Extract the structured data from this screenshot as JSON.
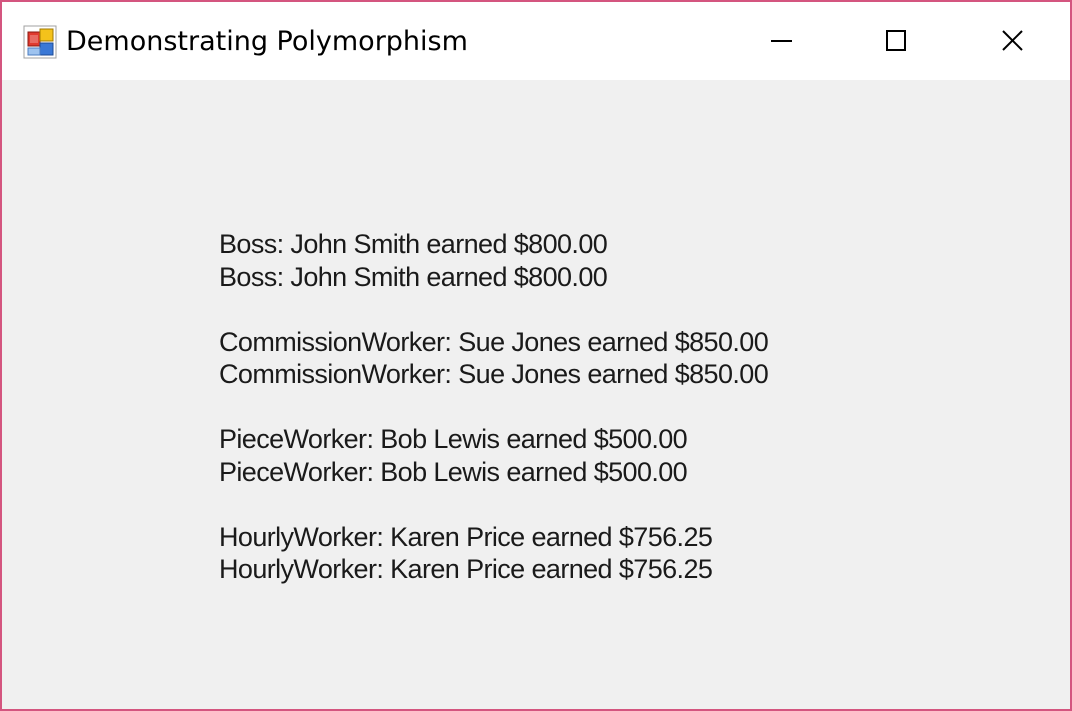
{
  "window": {
    "title": "Demonstrating Polymorphism",
    "icon": "winforms-app-icon",
    "border_color": "#d4557f",
    "client_background": "#f0f0f0"
  },
  "controls": {
    "minimize_icon": "minimize-icon",
    "maximize_icon": "maximize-icon",
    "close_icon": "close-icon"
  },
  "output": {
    "groups": [
      {
        "lines": [
          "Boss: John Smith earned $800.00",
          "Boss: John Smith earned $800.00"
        ]
      },
      {
        "lines": [
          "CommissionWorker: Sue Jones earned $850.00",
          "CommissionWorker: Sue Jones earned $850.00"
        ]
      },
      {
        "lines": [
          "PieceWorker: Bob Lewis earned $500.00",
          "PieceWorker: Bob Lewis earned $500.00"
        ]
      },
      {
        "lines": [
          "HourlyWorker: Karen Price earned $756.25",
          "HourlyWorker: Karen Price earned $756.25"
        ]
      }
    ]
  }
}
